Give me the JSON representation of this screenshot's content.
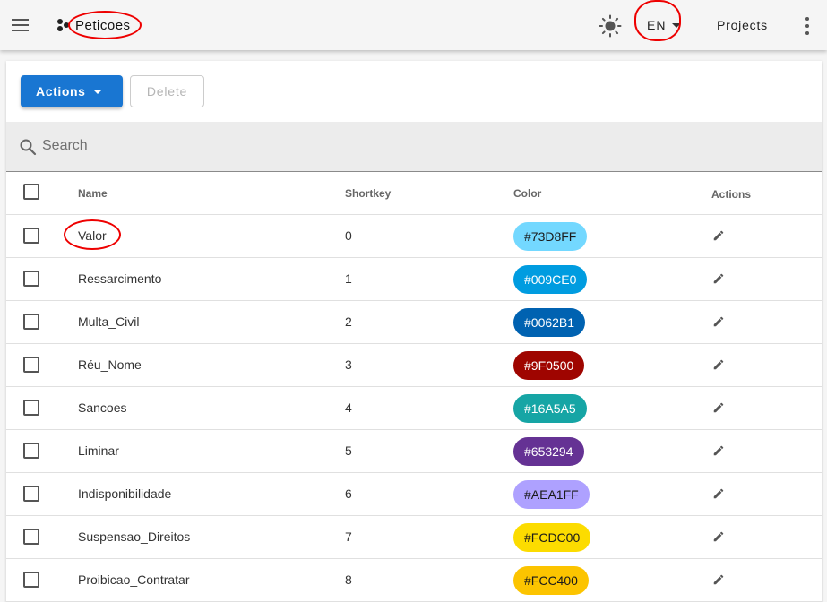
{
  "appbar": {
    "menu_icon": "menu-icon",
    "brand": "Peticoes",
    "theme_icon": "brightness-icon",
    "language": "EN",
    "projects_label": "Projects",
    "more_icon": "more-vert-icon"
  },
  "toolbar": {
    "actions_label": "Actions",
    "delete_label": "Delete"
  },
  "search": {
    "placeholder": "Search"
  },
  "table": {
    "headers": {
      "name": "Name",
      "shortkey": "Shortkey",
      "color": "Color",
      "actions": "Actions"
    },
    "rows": [
      {
        "name": "Valor",
        "shortkey": "0",
        "color": "#73D8FF",
        "text_color": "#1a1a1a"
      },
      {
        "name": "Ressarcimento",
        "shortkey": "1",
        "color": "#009CE0",
        "text_color": "#ffffff"
      },
      {
        "name": "Multa_Civil",
        "shortkey": "2",
        "color": "#0062B1",
        "text_color": "#ffffff"
      },
      {
        "name": "Réu_Nome",
        "shortkey": "3",
        "color": "#9F0500",
        "text_color": "#ffffff"
      },
      {
        "name": "Sancoes",
        "shortkey": "4",
        "color": "#16A5A5",
        "text_color": "#ffffff"
      },
      {
        "name": "Liminar",
        "shortkey": "5",
        "color": "#653294",
        "text_color": "#ffffff"
      },
      {
        "name": "Indisponibilidade",
        "shortkey": "6",
        "color": "#AEA1FF",
        "text_color": "#1a1a1a"
      },
      {
        "name": "Suspensao_Direitos",
        "shortkey": "7",
        "color": "#FCDC00",
        "text_color": "#1a1a1a"
      },
      {
        "name": "Proibicao_Contratar",
        "shortkey": "8",
        "color": "#FCC400",
        "text_color": "#1a1a1a"
      }
    ]
  },
  "colors": {
    "primary": "#1976d2",
    "annotation": "#e00000"
  }
}
